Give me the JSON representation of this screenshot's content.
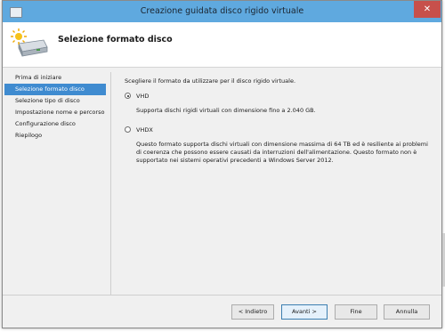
{
  "window": {
    "title": "Creazione guidata disco rigido virtuale",
    "close_label": "✕"
  },
  "header": {
    "title": "Selezione formato disco",
    "icon": "hard-disk-wizard-icon"
  },
  "sidebar": {
    "items": [
      {
        "label": "Prima di iniziare",
        "active": false
      },
      {
        "label": "Selezione formato disco",
        "active": true
      },
      {
        "label": "Selezione tipo di disco",
        "active": false
      },
      {
        "label": "Impostazione nome e percorso",
        "active": false
      },
      {
        "label": "Configurazione disco",
        "active": false
      },
      {
        "label": "Riepilogo",
        "active": false
      }
    ]
  },
  "content": {
    "intro": "Scegliere il formato da utilizzare per il disco rigido virtuale.",
    "options": [
      {
        "label": "VHD",
        "checked": true,
        "description": "Supporta dischi rigidi virtuali con dimensione fino a 2.040 GB."
      },
      {
        "label": "VHDX",
        "checked": false,
        "description": "Questo formato supporta dischi virtuali con dimensione massima di 64 TB ed è resiliente ai problemi di coerenza che possono essere causati da interruzioni dell'alimentazione. Questo formato non è supportato nei sistemi operativi precedenti a Windows Server 2012."
      }
    ]
  },
  "footer": {
    "back_label": "< Indietro",
    "next_label": "Avanti >",
    "finish_label": "Fine",
    "cancel_label": "Annulla"
  },
  "colors": {
    "titlebar": "#5fa9df",
    "active_nav": "#3f8bd0",
    "close_button": "#c7504b"
  }
}
